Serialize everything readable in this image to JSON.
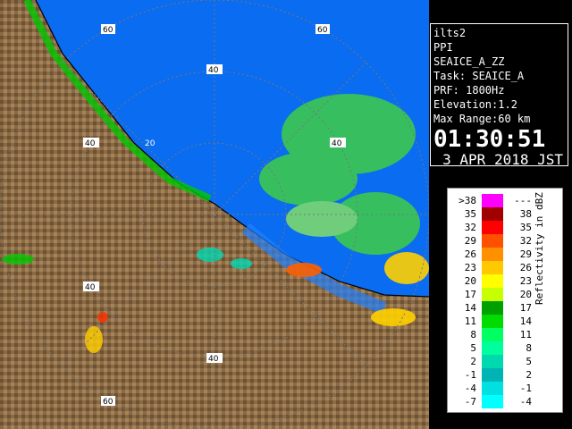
{
  "info": {
    "site": "ilts2",
    "mode": "PPI",
    "product": "SEAICE_A_ZZ",
    "task": "Task: SEAICE_A",
    "prf": "PRF: 1800Hz",
    "elevation": "Elevation:1.2",
    "max_range": "Max Range:60 km",
    "time": "01:30:51",
    "date": "3 APR 2018 JST"
  },
  "legend": {
    "title": "Reflectivity in dBZ",
    "rows": [
      {
        "lo": ">38",
        "hi": "---",
        "color": "#ff00ff"
      },
      {
        "lo": "35",
        "hi": "38",
        "color": "#a00000"
      },
      {
        "lo": "32",
        "hi": "35",
        "color": "#ff0000"
      },
      {
        "lo": "29",
        "hi": "32",
        "color": "#ff5000"
      },
      {
        "lo": "26",
        "hi": "29",
        "color": "#ff9000"
      },
      {
        "lo": "23",
        "hi": "26",
        "color": "#ffc800"
      },
      {
        "lo": "20",
        "hi": "23",
        "color": "#ffff00"
      },
      {
        "lo": "17",
        "hi": "20",
        "color": "#c8ff00"
      },
      {
        "lo": "14",
        "hi": "17",
        "color": "#00a000"
      },
      {
        "lo": "11",
        "hi": "14",
        "color": "#00dc00"
      },
      {
        "lo": "8",
        "hi": "11",
        "color": "#00ff60"
      },
      {
        "lo": "5",
        "hi": "8",
        "color": "#00ff9c"
      },
      {
        "lo": "2",
        "hi": "5",
        "color": "#00d8b0"
      },
      {
        "lo": "-1",
        "hi": "2",
        "color": "#00b4b4"
      },
      {
        "lo": "-4",
        "hi": "-1",
        "color": "#00e0e0"
      },
      {
        "lo": "-7",
        "hi": "-4",
        "color": "#00ffff"
      }
    ]
  },
  "map": {
    "range_labels": [
      "20",
      "40",
      "40",
      "40",
      "40",
      "40",
      "60",
      "60",
      "60"
    ],
    "sea_color": "#0a6cf0",
    "land_color": "#8a6a45"
  }
}
